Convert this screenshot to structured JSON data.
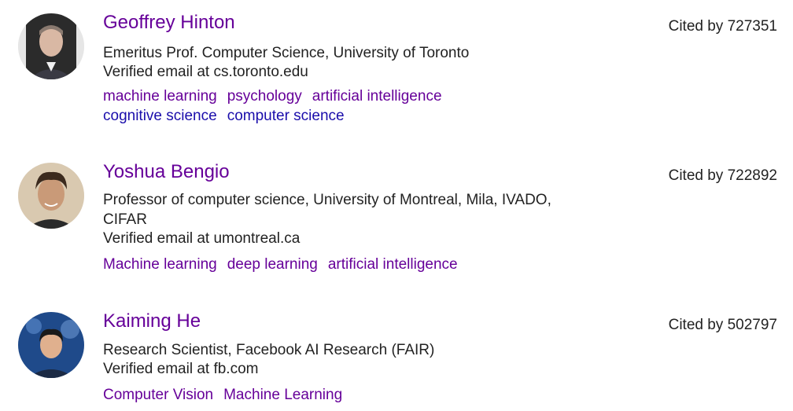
{
  "profiles": [
    {
      "name": "Geoffrey Hinton",
      "affiliation": "Emeritus Prof. Computer Science, University of Toronto",
      "email": "Verified email at cs.toronto.edu",
      "interests": [
        "machine learning",
        "psychology",
        "artificial intelligence",
        "cognitive science",
        "computer science"
      ],
      "cited_by": "Cited by 727351",
      "avatar": "profile-photo"
    },
    {
      "name": "Yoshua Bengio",
      "affiliation": "Professor of computer science, University of Montreal, Mila, IVADO, CIFAR",
      "email": "Verified email at umontreal.ca",
      "interests": [
        "Machine learning",
        "deep learning",
        "artificial intelligence"
      ],
      "cited_by": "Cited by 722892",
      "avatar": "profile-photo"
    },
    {
      "name": "Kaiming He",
      "affiliation": "Research Scientist, Facebook AI Research (FAIR)",
      "email": "Verified email at fb.com",
      "interests": [
        "Computer Vision",
        "Machine Learning"
      ],
      "cited_by": "Cited by 502797",
      "avatar": "profile-photo"
    }
  ],
  "colors": {
    "link_visited": "#660099",
    "link_unvisited": "#1a0dab",
    "text": "#222222"
  }
}
